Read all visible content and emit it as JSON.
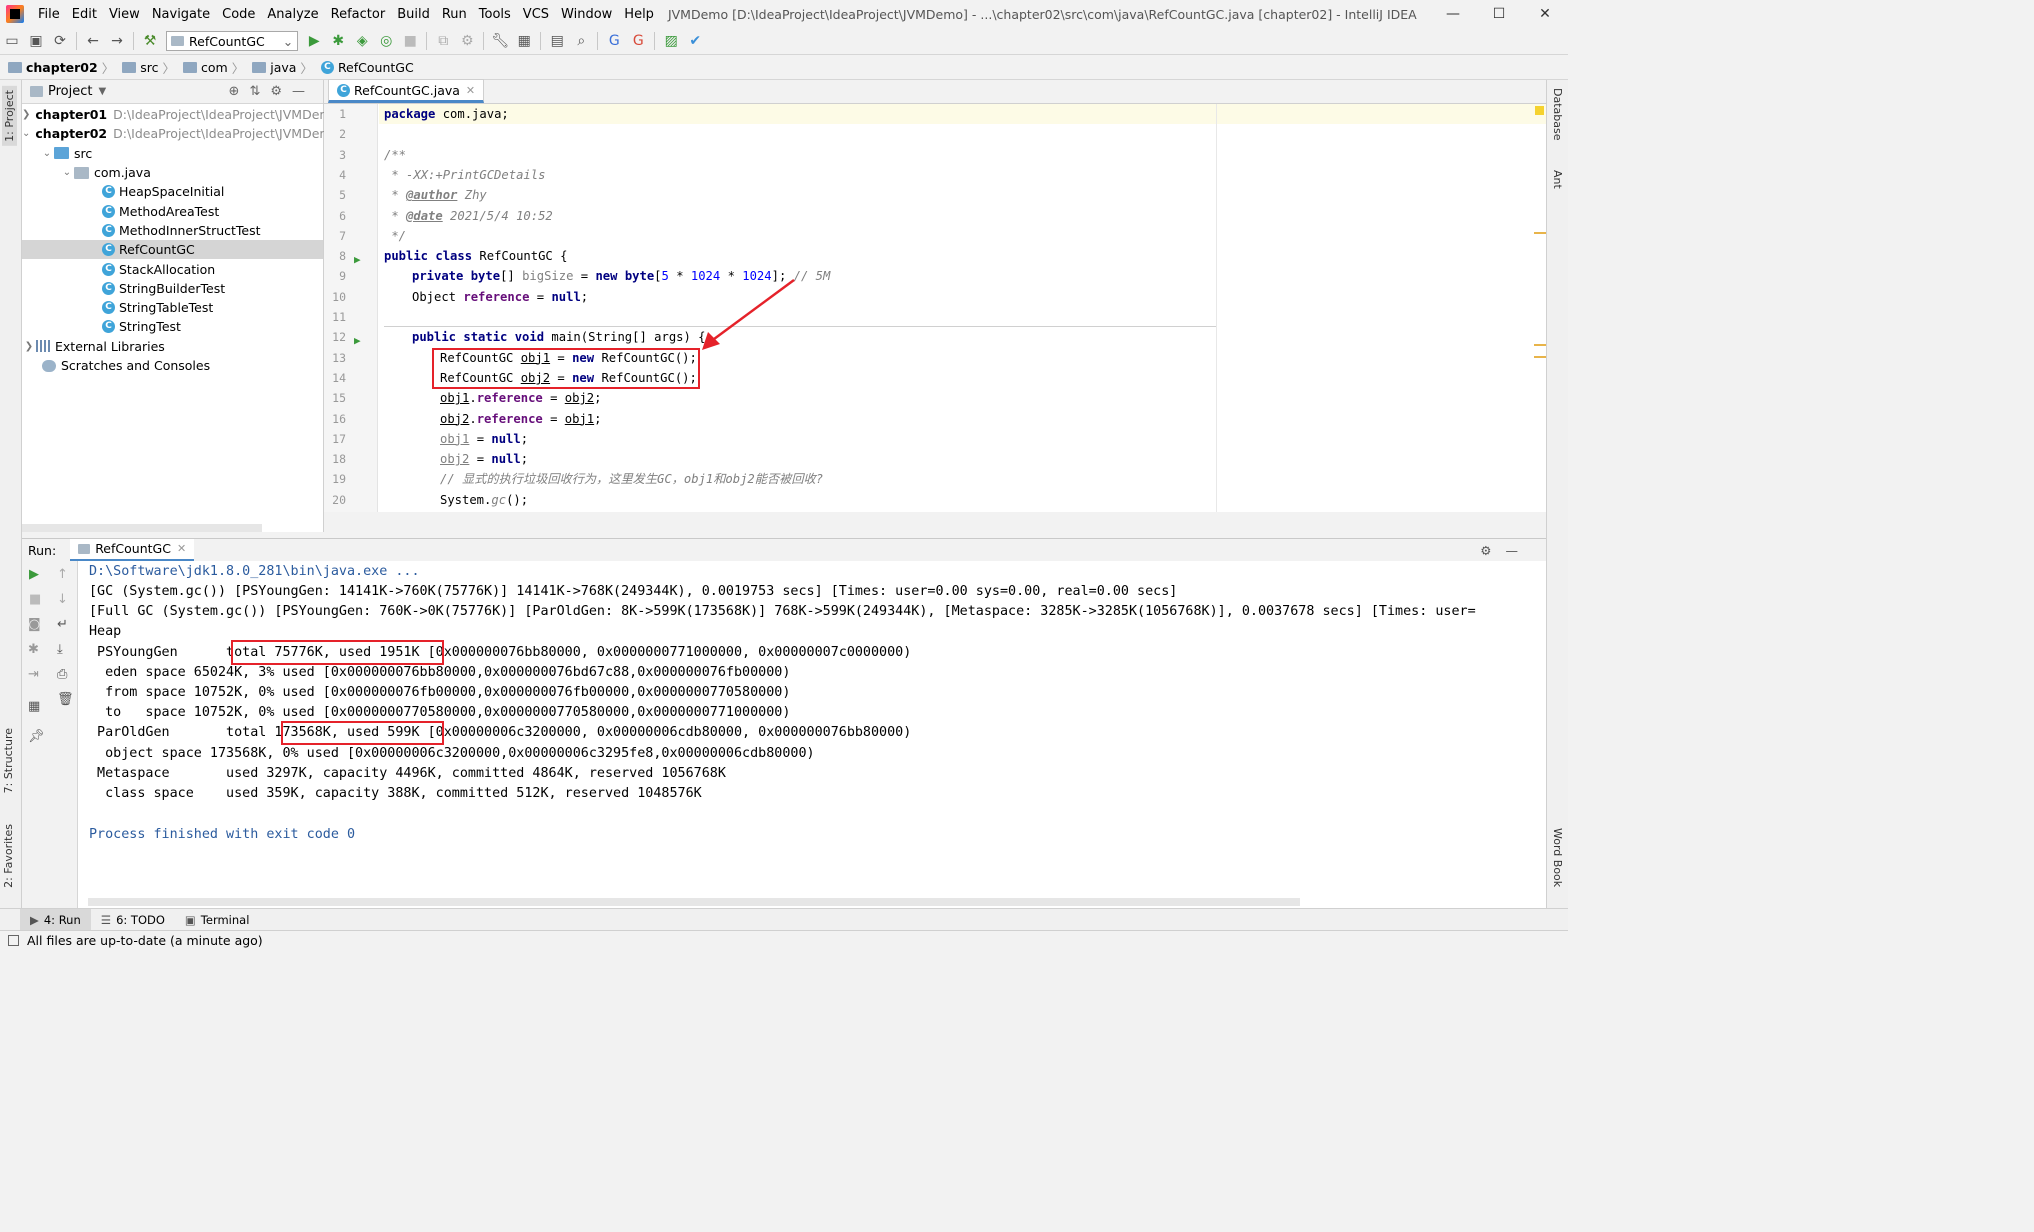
{
  "menu": {
    "items": [
      "File",
      "Edit",
      "View",
      "Navigate",
      "Code",
      "Analyze",
      "Refactor",
      "Build",
      "Run",
      "Tools",
      "VCS",
      "Window",
      "Help"
    ],
    "title": "JVMDemo [D:\\IdeaProject\\IdeaProject\\JVMDemo] - ...\\chapter02\\src\\com\\java\\RefCountGC.java [chapter02] - IntelliJ IDEA"
  },
  "toolbar": {
    "run_config": "RefCountGC"
  },
  "breadcrumb": [
    "chapter02",
    "src",
    "com",
    "java",
    "RefCountGC"
  ],
  "left_strip": {
    "project": "1: Project",
    "structure": "7: Structure",
    "favorites": "2: Favorites"
  },
  "right_strip": {
    "database": "Database",
    "ant": "Ant",
    "wordbook": "Word Book"
  },
  "project": {
    "header": "Project",
    "tree": [
      {
        "label": "chapter01",
        "path": "D:\\IdeaProject\\IdeaProject\\JVMDem"
      },
      {
        "label": "chapter02",
        "path": "D:\\IdeaProject\\IdeaProject\\JVMDem"
      },
      {
        "label": "src"
      },
      {
        "label": "com.java"
      },
      {
        "label": "HeapSpaceInitial"
      },
      {
        "label": "MethodAreaTest"
      },
      {
        "label": "MethodInnerStructTest"
      },
      {
        "label": "RefCountGC"
      },
      {
        "label": "StackAllocation"
      },
      {
        "label": "StringBuilderTest"
      },
      {
        "label": "StringTableTest"
      },
      {
        "label": "StringTest"
      },
      {
        "label": "External Libraries"
      },
      {
        "label": "Scratches and Consoles"
      }
    ]
  },
  "editor": {
    "tab": "RefCountGC.java",
    "line_numbers": [
      "1",
      "2",
      "3",
      "4",
      "5",
      "6",
      "7",
      "8",
      "9",
      "10",
      "11",
      "12",
      "13",
      "14",
      "15",
      "16",
      "17",
      "18",
      "19",
      "20"
    ],
    "code": {
      "l1_kw": "package",
      "l1_rest": " com.java;",
      "l3": "/**",
      "l4": " * -XX:+PrintGCDetails",
      "l5_pre": " * ",
      "l5_tag": "@author",
      "l5_rest": " Zhy",
      "l6_pre": " * ",
      "l6_tag": "@date",
      "l6_rest": " 2021/5/4 10:52",
      "l7": " */",
      "l8_kw": "public class",
      "l8_rest": " RefCountGC {",
      "l9_kw1": "private byte",
      "l9_a": "[] ",
      "l9_fld": "bigSize",
      "l9_b": " = ",
      "l9_kw2": "new byte",
      "l9_c": "[",
      "l9_n1": "5",
      "l9_d": " * ",
      "l9_n2": "1024",
      "l9_e": " * ",
      "l9_n3": "1024",
      "l9_f": "]; ",
      "l9_cm": "// 5M",
      "l10_a": "Object ",
      "l10_fld": "reference",
      "l10_b": " = ",
      "l10_kw": "null",
      "l10_c": ";",
      "l12_kw": "public static void",
      "l12_rest": " main(String[] args) {",
      "l13_a": "RefCountGC ",
      "l13_var": "obj1",
      "l13_b": " = ",
      "l13_kw": "new",
      "l13_c": " RefCountGC();",
      "l14_a": "RefCountGC ",
      "l14_var": "obj2",
      "l14_b": " = ",
      "l14_kw": "new",
      "l14_c": " RefCountGC();",
      "l15_var": "obj1",
      "l15_a": ".",
      "l15_fld": "reference",
      "l15_b": " = ",
      "l15_var2": "obj2",
      "l15_c": ";",
      "l16_var": "obj2",
      "l16_a": ".",
      "l16_fld": "reference",
      "l16_b": " = ",
      "l16_var2": "obj1",
      "l16_c": ";",
      "l17_var": "obj1",
      "l17_a": " = ",
      "l17_kw": "null",
      "l17_b": ";",
      "l18_var": "obj2",
      "l18_a": " = ",
      "l18_kw": "null",
      "l18_b": ";",
      "l19": "// 显式的执行垃圾回收行为，这里发生GC，obj1和obj2能否被回收?",
      "l20_a": "System.",
      "l20_m": "gc",
      "l20_b": "();"
    }
  },
  "run": {
    "label": "Run:",
    "tab": "RefCountGC",
    "console": {
      "l1": "D:\\Software\\jdk1.8.0_281\\bin\\java.exe ...",
      "l2": "[GC (System.gc()) [PSYoungGen: 14141K->760K(75776K)] 14141K->768K(249344K), 0.0019753 secs] [Times: user=0.00 sys=0.00, real=0.00 secs]",
      "l3": "[Full GC (System.gc()) [PSYoungGen: 760K->0K(75776K)] [ParOldGen: 8K->599K(173568K)] 768K->599K(249344K), [Metaspace: 3285K->3285K(1056768K)], 0.0037678 secs] [Times: user=",
      "l4": "Heap",
      "l5": " PSYoungGen      total 75776K, used 1951K [0x000000076bb80000, 0x0000000771000000, 0x00000007c0000000)",
      "l6": "  eden space 65024K, 3% used [0x000000076bb80000,0x000000076bd67c88,0x000000076fb00000)",
      "l7": "  from space 10752K, 0% used [0x000000076fb00000,0x000000076fb00000,0x0000000770580000)",
      "l8": "  to   space 10752K, 0% used [0x0000000770580000,0x0000000770580000,0x0000000771000000)",
      "l9": " ParOldGen       total 173568K, used 599K [0x00000006c3200000, 0x00000006cdb80000, 0x000000076bb80000)",
      "l10": "  object space 173568K, 0% used [0x00000006c3200000,0x00000006c3295fe8,0x00000006cdb80000)",
      "l11": " Metaspace       used 3297K, capacity 4496K, committed 4864K, reserved 1056768K",
      "l12": "  class space    used 359K, capacity 388K, committed 512K, reserved 1048576K",
      "l14": "Process finished with exit code 0"
    }
  },
  "bottom_tabs": [
    "4: Run",
    "6: TODO",
    "Terminal"
  ],
  "status": "All files are up-to-date (a minute ago)",
  "colors": {
    "accent": "#4a88c7",
    "highlight_box": "#e5222a"
  }
}
